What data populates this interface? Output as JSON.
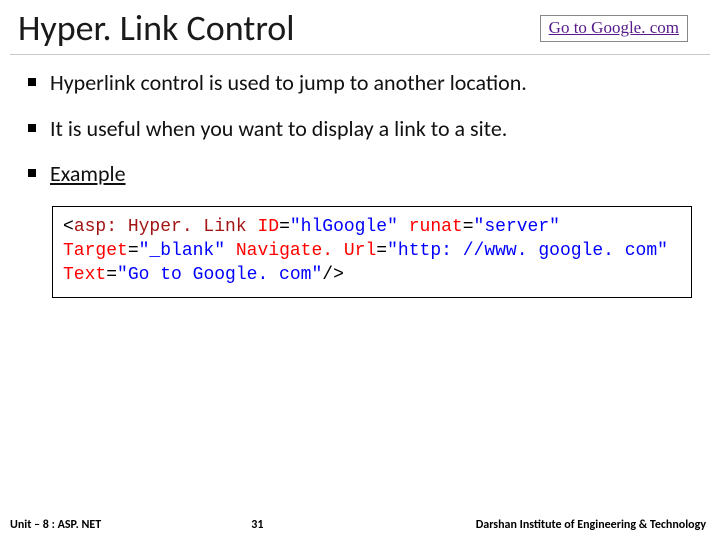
{
  "header": {
    "title": "Hyper. Link Control",
    "demo_link_text": "Go to Google. com"
  },
  "bullets": {
    "b1": "Hyperlink control is used to jump to another location.",
    "b2": "It is useful when you want to display a link to a site.",
    "b3": "Example"
  },
  "code": {
    "seg_open": "<",
    "seg_tag": "asp: Hyper. Link",
    "seg_sp": " ",
    "attr_id": "ID",
    "eq": "=",
    "val_id": "\"hlGoogle\"",
    "attr_runat": "runat",
    "val_runat": "\"server\"",
    "attr_target": "Target",
    "val_target": "\"_blank\"",
    "attr_nav": "Navigate. Url",
    "val_nav": "\"http: //www. google. com\"",
    "attr_text": "Text",
    "val_text": "\"Go to Google. com\"",
    "seg_close": "/>"
  },
  "footer": {
    "unit": "Unit – 8 : ASP. NET",
    "page": "31",
    "institute": "Darshan Institute of Engineering & Technology"
  }
}
